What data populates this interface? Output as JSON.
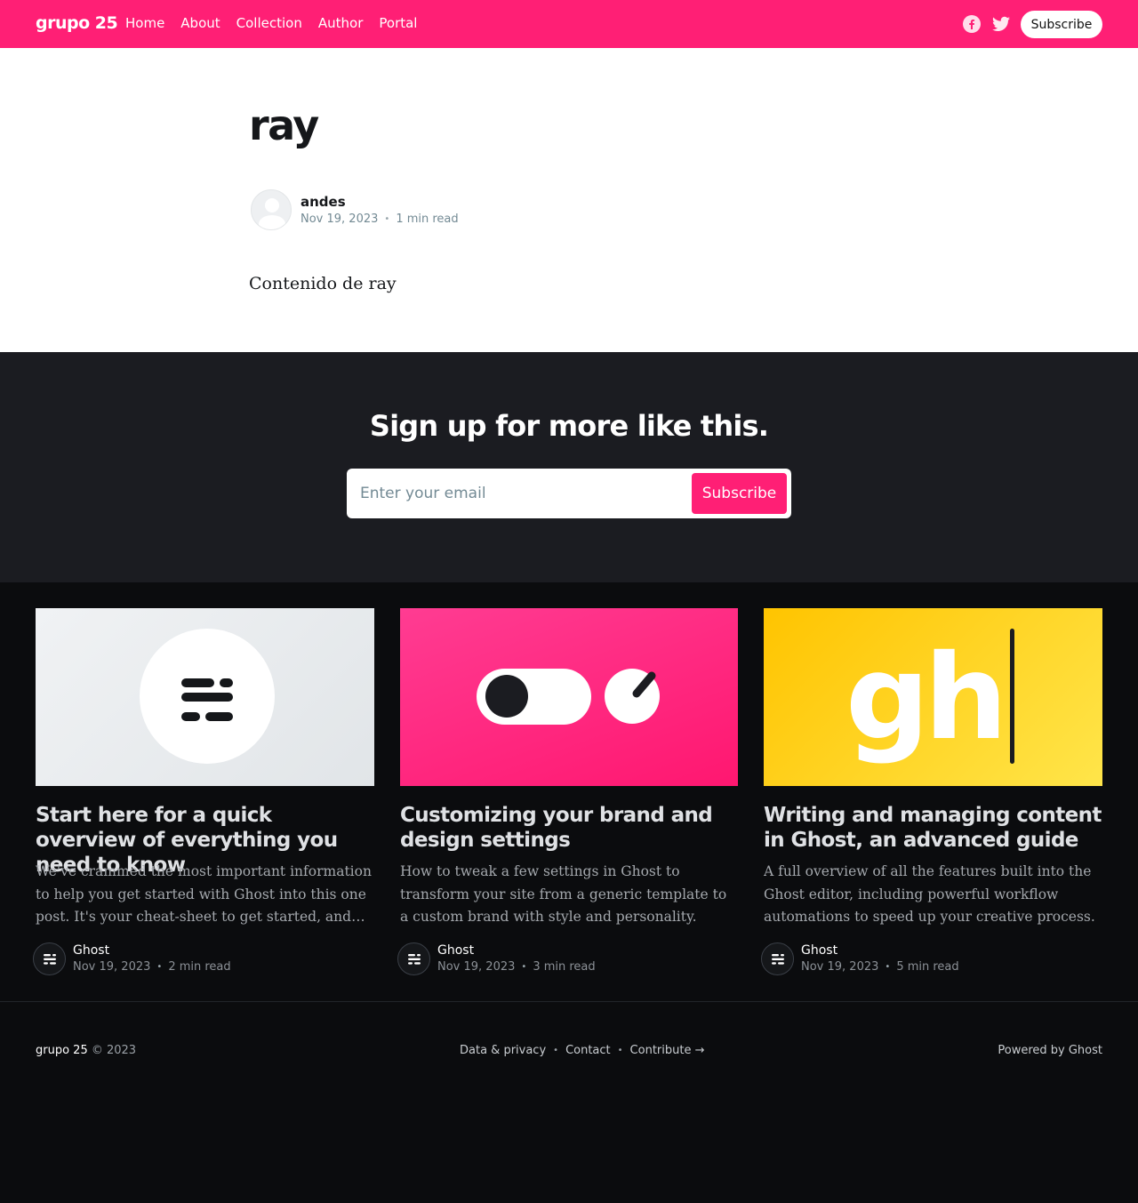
{
  "header": {
    "logo": "grupo 25",
    "nav": [
      "Home",
      "About",
      "Collection",
      "Author",
      "Portal"
    ],
    "social": [
      "facebook-icon",
      "twitter-icon"
    ],
    "subscribe_label": "Subscribe",
    "accent_color": "#ff1f75"
  },
  "article": {
    "title": "ray",
    "author": "andes",
    "date": "Nov 19, 2023",
    "reading_time": "1 min read",
    "body": "Contenido de ray"
  },
  "cta": {
    "title": "Sign up for more like this.",
    "email_placeholder": "Enter your email",
    "button_label": "Subscribe"
  },
  "feed": {
    "posts": [
      {
        "title": "Start here for a quick overview of everything you need to know",
        "excerpt": "We've crammed the most important information to help you get started with Ghost into this one post. It's your cheat-sheet to get started, and your shortcut to advanced features.",
        "author": "Ghost",
        "date": "Nov 19, 2023",
        "reading_time": "2 min read",
        "image": "ghost-logo-illustration"
      },
      {
        "title": "Customizing your brand and design settings",
        "excerpt": "How to tweak a few settings in Ghost to transform your site from a generic template to a custom brand with style and personality.",
        "author": "Ghost",
        "date": "Nov 19, 2023",
        "reading_time": "3 min read",
        "image": "toggle-dial-illustration"
      },
      {
        "title": "Writing and managing content in Ghost, an advanced guide",
        "excerpt": "A full overview of all the features built into the Ghost editor, including powerful workflow automations to speed up your creative process.",
        "author": "Ghost",
        "date": "Nov 19, 2023",
        "reading_time": "5 min read",
        "image": "gh-cursor-illustration",
        "image_text": "gh"
      }
    ]
  },
  "footer": {
    "brand": "grupo 25",
    "copyright": " © 2023",
    "links": [
      "Data & privacy",
      "Contact",
      "Contribute →"
    ],
    "powered": "Powered by Ghost"
  }
}
